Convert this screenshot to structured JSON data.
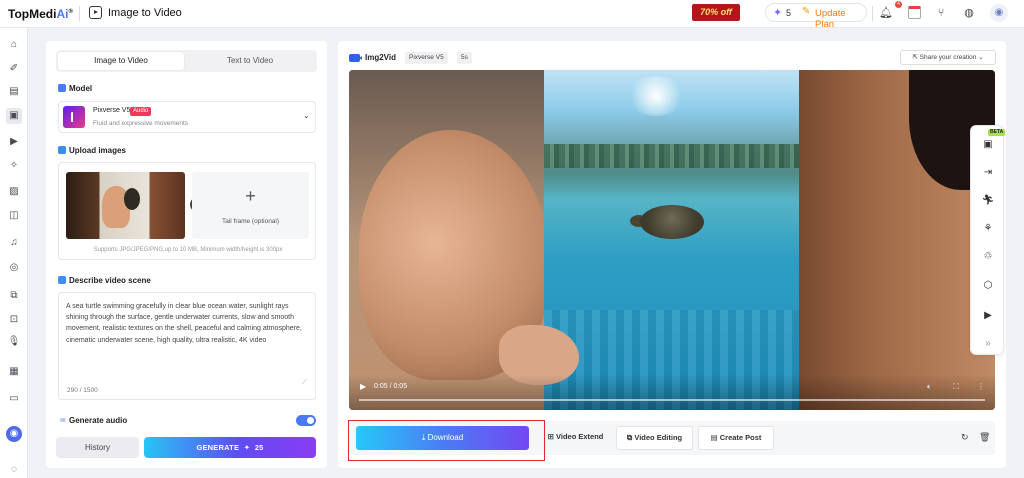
{
  "topbar": {
    "brand": "TopMedi",
    "brand_suffix": "Ai",
    "reg": "®",
    "page_title": "Image to Video",
    "promo": "70% off",
    "credits": "5",
    "update_plan": "Update Plan",
    "bell_badge": "4"
  },
  "left_panel": {
    "tabs": [
      "Image to Video",
      "Text to Video"
    ],
    "model_section": "Model",
    "model_name": "Pixverse V5",
    "audio_badge": "Audio",
    "model_desc": "Fluid and expressive movements",
    "upload_section": "Upload images",
    "tail_frame_label": "Tail frame (optional)",
    "tail_frame_plus": "+",
    "upload_hint": "Supports JPG/JPEG/PNG,up to 10 MB, Minimum width/height is 300px",
    "describe_section": "Describe video scene",
    "prompt": "A sea turtle swimming gracefully in clear blue ocean water, sunlight rays shining through the surface, gentle underwater currents, slow and smooth movement, realistic textures on the shell, peaceful and calming atmosphere, cinematic underwater scene, high quality, ultra realistic, 4K video",
    "char_count": "290 / 1500",
    "generate_audio": "Generate audio",
    "generate_audio_on": true,
    "history_btn": "History",
    "generate_btn": "GENERATE",
    "generate_cost": "25"
  },
  "result_panel": {
    "title": "Img2Vid",
    "chips": [
      "Pixverse V5",
      "5s"
    ],
    "share": "Share your creation",
    "time": "0:05 / 0:05",
    "download": "Download",
    "video_extend": "Video Extend",
    "video_editing": "Video Editing",
    "create_post": "Create Post"
  },
  "float_toolbar": {
    "beta": "BETA"
  },
  "colors": {
    "accent_blue": "#4b79f3",
    "highlight_red": "#e2262a",
    "update_orange": "#f07d00"
  }
}
